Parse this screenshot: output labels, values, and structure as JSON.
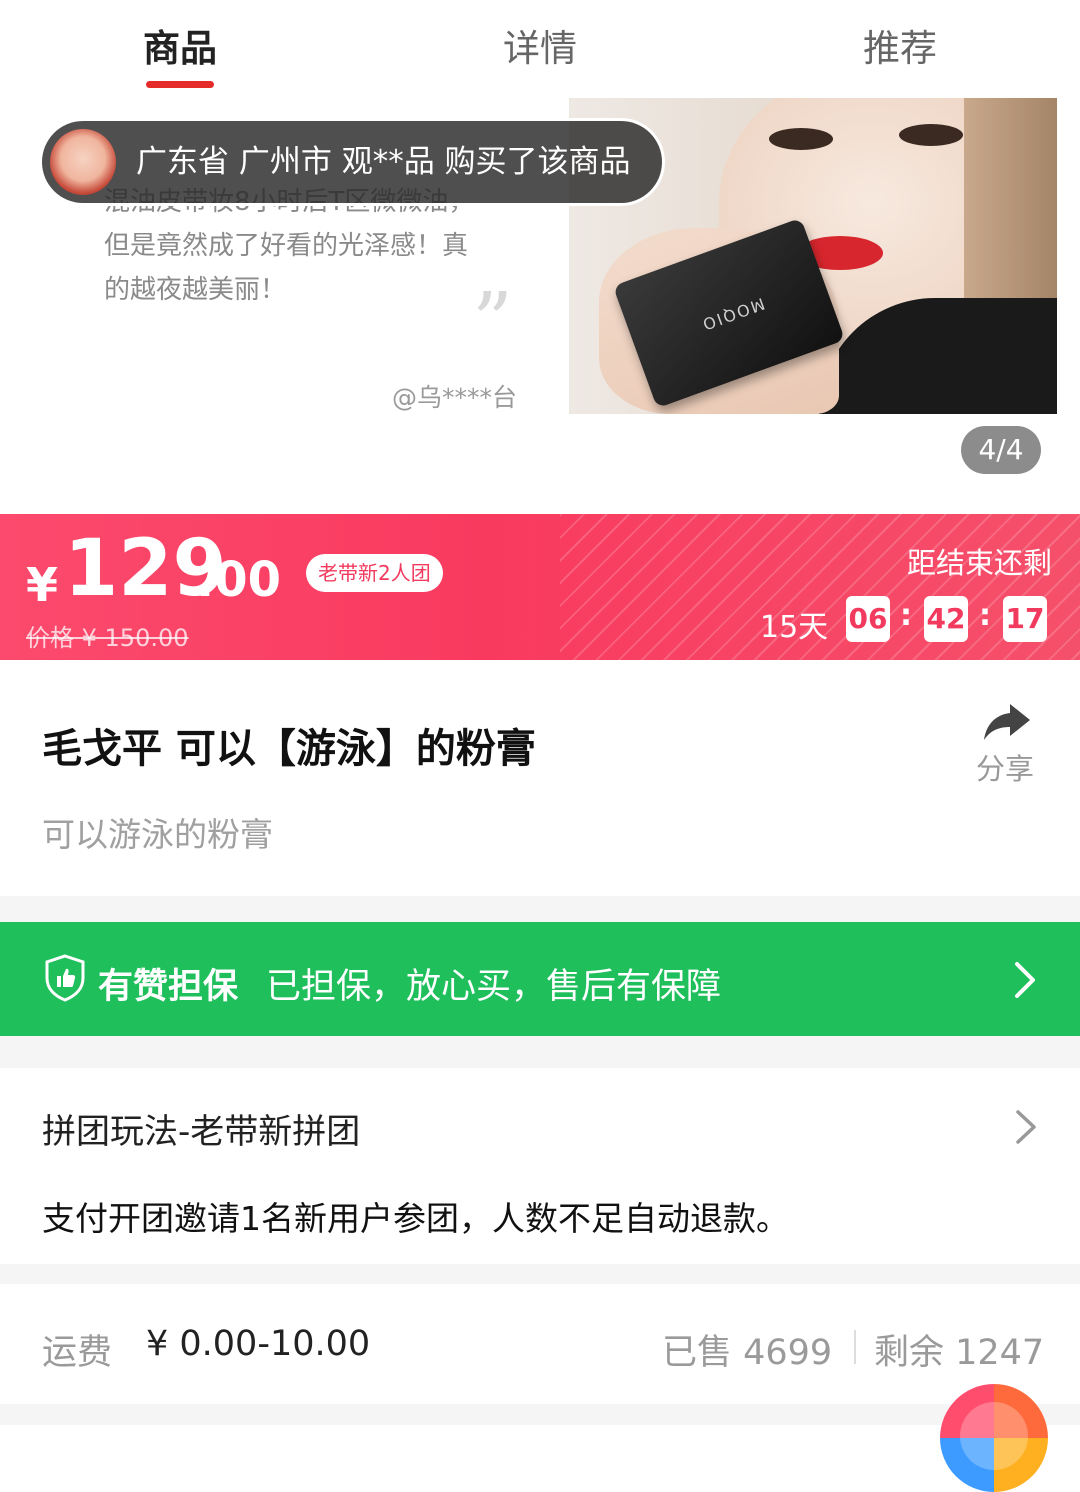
{
  "tabs": [
    {
      "label": "商品",
      "active": true
    },
    {
      "label": "详情",
      "active": false
    },
    {
      "label": "推荐",
      "active": false
    }
  ],
  "gallery": {
    "review_lines": [
      "混油皮带妆8小时后T区微微油，",
      "但是竟然成了好看的光泽感！真",
      "的越夜越美丽！"
    ],
    "review_quote": "”",
    "review_author": "@乌****台",
    "product_logo": "MOQIO",
    "counter": "4/4"
  },
  "toast": {
    "text": "广东省 广州市 观**品 购买了该商品"
  },
  "price": {
    "currency": "¥",
    "integer": "129",
    "decimal": ".00",
    "group_badge": "老带新2人团",
    "original": "价格 ¥ 150.00",
    "countdown_label": "距结束还剩",
    "days": "15天",
    "hours": "06",
    "minutes": "42",
    "seconds": "17",
    "colon": ":",
    "colors": {
      "banner": "#f93a5f",
      "accent": "#f23a5e"
    }
  },
  "product": {
    "title": "毛戈平 可以【游泳】的粉膏",
    "subtitle": "可以游泳的粉膏",
    "share_label": "分享",
    "share_icon": "share-arrow-icon"
  },
  "guarantee": {
    "title": "有赞担保",
    "description": "已担保，放心买，售后有保障",
    "icon": "shield-thumb-icon",
    "color": "#1fbf5c"
  },
  "group_play": {
    "title": "拼团玩法-老带新拼团",
    "description": "支付开团邀请1名新用户参团，人数不足自动退款。"
  },
  "shipping": {
    "label": "运费",
    "value": "¥ 0.00-10.00",
    "sold": "已售 4699",
    "remaining": "剩余 1247"
  }
}
